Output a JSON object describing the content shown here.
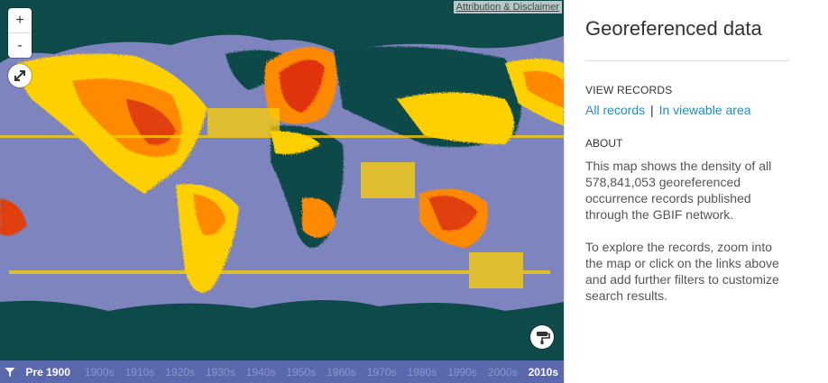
{
  "map": {
    "attribution": "Attribution & Disclaimer",
    "zoom_in": "+",
    "zoom_out": "-"
  },
  "timeline": {
    "decades": [
      "Pre 1900",
      "1900s",
      "1910s",
      "1920s",
      "1930s",
      "1940s",
      "1950s",
      "1960s",
      "1970s",
      "1980s",
      "1990s",
      "2000s",
      "2010s"
    ],
    "active": [
      "Pre 1900",
      "2010s"
    ]
  },
  "panel": {
    "title": "Georeferenced data",
    "view_records_heading": "VIEW RECORDS",
    "link_all": "All records",
    "link_separator": "|",
    "link_viewable": "In viewable area",
    "about_heading": "ABOUT",
    "about_p1": "This map shows the density of all 578,841,053 georeferenced occurrence records published through the GBIF network.",
    "about_p2": "To explore the records, zoom into the map or click on the links above and add further filters to customize search results."
  },
  "colors": {
    "ocean": "#7e84bd",
    "land": "#0e4a4a",
    "low_density": "#ffe600",
    "mid_density": "#ff8c00",
    "high_density": "#e03010",
    "timebar": "#5a68ae",
    "link": "#1f8ec9"
  }
}
